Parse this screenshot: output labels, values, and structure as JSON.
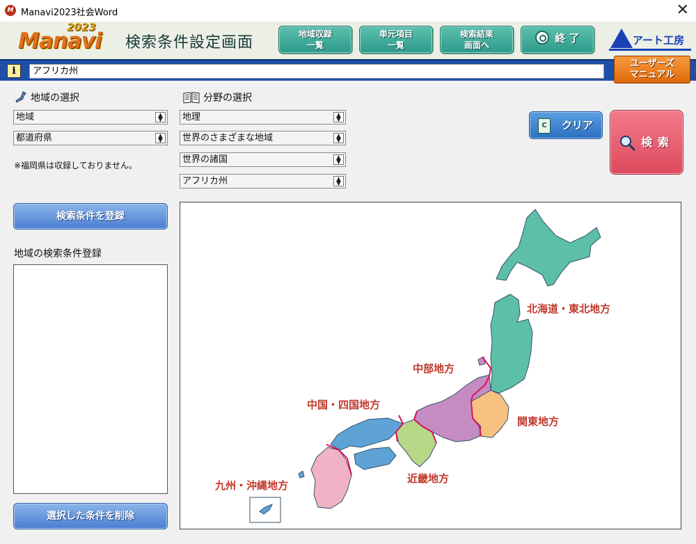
{
  "window": {
    "title": "Manavi2023社会Word",
    "close_glyph": "✕"
  },
  "header": {
    "logo_text": "Manavi",
    "logo_year": "2023",
    "screen_title": "検索条件設定画面",
    "buttons": {
      "region_list": [
        "地域収録",
        "一覧"
      ],
      "unit_list": [
        "単元項目",
        "一覧"
      ],
      "to_results": [
        "検索結果",
        "画面へ"
      ],
      "end": "終 了"
    },
    "company_logo": "アート工房",
    "manual_button": [
      "ユーザーズ",
      "マニュアル"
    ]
  },
  "infobar": {
    "icon": "i",
    "value": "アフリカ州"
  },
  "region_select": {
    "heading": "地域の選択",
    "combo1": "地域",
    "combo2": "都道府県",
    "note": "※福岡県は収録しておりません。"
  },
  "field_select": {
    "heading": "分野の選択",
    "combo1": "地理",
    "combo2": "世界のさまざまな地域",
    "combo3": "世界の諸国",
    "combo4": "アフリカ州"
  },
  "left_panel": {
    "register_button": "検索条件を登録",
    "register_label": "地域の検索条件登録",
    "delete_button": "選択した条件を削除"
  },
  "right_panel": {
    "clear_button": "クリア",
    "clear_icon_glyph": "C",
    "search_button": "検索"
  },
  "map": {
    "regions": {
      "hokkaido_tohoku": "北海道・東北地方",
      "chubu": "中部地方",
      "kanto": "関東地方",
      "chugoku_shikoku": "中国・四国地方",
      "kinki": "近畿地方",
      "kyushu_okinawa": "九州・沖縄地方"
    },
    "colors": {
      "hokkaido_tohoku": "#5dbfa8",
      "chubu": "#c58cc4",
      "kanto": "#f7c182",
      "kinki": "#b6d887",
      "chugoku_shikoku": "#5fa3d6",
      "kyushu_okinawa": "#f2b2c6",
      "border": "#d4145a",
      "label": "#c0392b"
    }
  },
  "theme": {
    "teal_button": "#2d9a8a",
    "blue_button": "#4a7ed0",
    "search_button": "#de4a5e",
    "infobar": "#1f4fa6",
    "manual_button": "#e06a08"
  }
}
